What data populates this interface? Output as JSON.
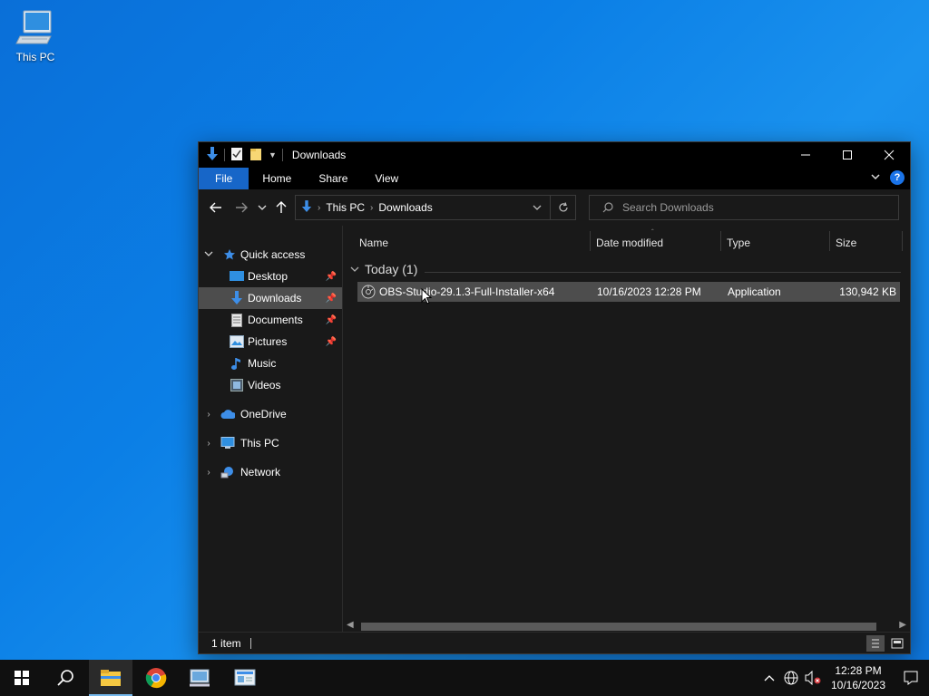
{
  "desktop": {
    "icons": [
      {
        "label": "This PC",
        "icon": "this-pc-icon"
      }
    ]
  },
  "window": {
    "title": "Downloads",
    "ribbon_tabs": [
      "File",
      "Home",
      "Share",
      "View"
    ],
    "address": {
      "crumbs": [
        "This PC",
        "Downloads"
      ]
    },
    "search": {
      "placeholder": "Search Downloads"
    },
    "nav_pane": {
      "items": [
        {
          "label": "Quick access",
          "icon": "star-icon",
          "expanded": true
        },
        {
          "label": "Desktop",
          "icon": "desktop-folder-icon",
          "pinned": true
        },
        {
          "label": "Downloads",
          "icon": "download-arrow-icon",
          "pinned": true,
          "selected": true
        },
        {
          "label": "Documents",
          "icon": "document-icon",
          "pinned": true
        },
        {
          "label": "Pictures",
          "icon": "pictures-icon",
          "pinned": true
        },
        {
          "label": "Music",
          "icon": "music-note-icon"
        },
        {
          "label": "Videos",
          "icon": "video-icon"
        },
        {
          "label": "OneDrive",
          "icon": "cloud-icon"
        },
        {
          "label": "This PC",
          "icon": "computer-icon"
        },
        {
          "label": "Network",
          "icon": "network-icon"
        }
      ]
    },
    "columns": [
      "Name",
      "Date modified",
      "Type",
      "Size"
    ],
    "group": {
      "label": "Today (1)"
    },
    "files": [
      {
        "name": "OBS-Studio-29.1.3-Full-Installer-x64",
        "date_modified": "10/16/2023 12:28 PM",
        "type": "Application",
        "size": "130,942 KB",
        "icon": "installer-disc-icon",
        "selected": true
      }
    ],
    "status": {
      "item_count": "1 item"
    }
  },
  "taskbar": {
    "apps": [
      "start-icon",
      "search-icon",
      "file-explorer-icon",
      "chrome-icon",
      "control-panel-icon",
      "network-settings-icon"
    ],
    "clock": {
      "time": "12:28 PM",
      "date": "10/16/2023"
    }
  },
  "colors": {
    "accent": "#1766c8",
    "selection": "#4d4d4d",
    "window_bg": "#191919",
    "titlebar_bg": "#000000"
  }
}
